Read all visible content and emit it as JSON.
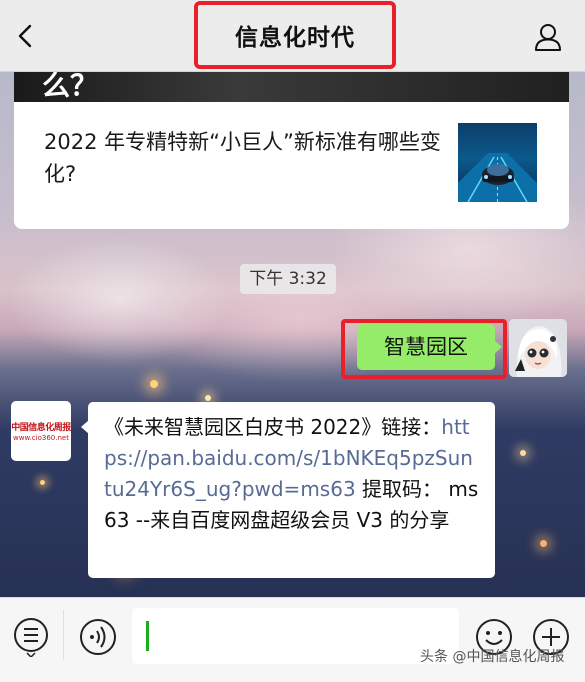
{
  "header": {
    "title": "信息化时代"
  },
  "article": {
    "top_snippet": "么？",
    "title": "2022 年专精特新“小巨人”新标准有哪些变化?"
  },
  "timestamp": "下午 3:32",
  "messages": {
    "mine": {
      "text": "智慧园区"
    },
    "theirs": {
      "avatar_logo": "中国信息化周报",
      "avatar_site": "www.cio360.net",
      "text_before_link": "《未来智慧园区白皮书 2022》链接：",
      "link": "https://pan.baidu.com/s/1bNKEq5pzSuntu24Yr6S_ug?pwd=ms63",
      "text_after_link": " 提取码：  ms63 --来自百度网盘超级会员 V3 的分享"
    }
  },
  "input_bar": {
    "watermark": "头条 @中国信息化周报",
    "icons": [
      "menu-icon",
      "voice-icon",
      "emoji-icon",
      "add-icon"
    ]
  },
  "colors": {
    "accent_green": "#95ec69",
    "highlight_red": "#e8202a",
    "link_blue": "#576b95"
  }
}
